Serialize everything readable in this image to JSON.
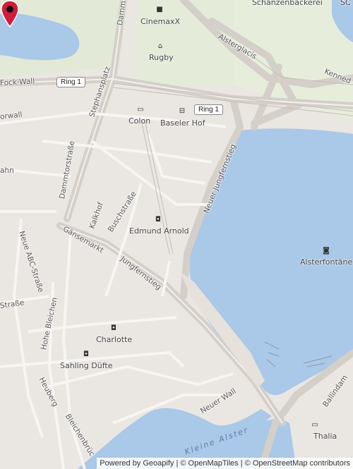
{
  "map": {
    "water_color": "#aac8e8",
    "land_color": "#eae6e1",
    "park_color": "#e4ecd9",
    "road_color": "#d2cdc6"
  },
  "labels": {
    "schanzenbackerei": "Schanzenbäckerei",
    "sc": "SC",
    "cinemaxx": "CinemaxX",
    "rugby": "Rugby",
    "alsterglacis": "Alsterglacis",
    "kennedy": "Kenned",
    "fock_wall": "Fock-Wall",
    "ring1_a": "Ring 1",
    "ring1_b": "Ring 1",
    "stephansplatz": "Stephansplatz",
    "dammtor_top": "Damm",
    "torwall": "orwall",
    "colon": "Colon",
    "baseler_hof": "Baseler Hof",
    "dammtorstrasse": "Dammtorstraße",
    "jungfernstieg_neuer": "Neuer Jungfernstieg",
    "ahn": "ahn",
    "kalkhof": "Kalkhof",
    "buschstrasse": "Buschstraße",
    "edmund_arnold": "Edmund Arnold",
    "gaensemarkt": "Gänsemarkt",
    "jungfernstieg": "Jungfernstieg",
    "neue_abc": "Neue ABC-Straße",
    "alsterfontaene": "Alsterfontäne",
    "strasse": "Straße",
    "hohe_bleichen": "Hohe Bleichen",
    "charlotte": "Charlotte",
    "sahling": "Sahling Düfte",
    "heuberg": "Heuberg",
    "bleichenbruecke": "Bleichenbrüc",
    "neuer_wall": "Neuer Wall",
    "kleine_alster": "Kleine Alster",
    "thalia": "Thalia",
    "ballindamm": "Ballindam"
  },
  "attribution": {
    "powered": "Powered by Geoapify",
    "sep1": "|",
    "openmaptiles": "© OpenMapTiles",
    "sep2": "|",
    "osm": "© OpenStreetMap contributors"
  },
  "icons": {
    "cinema": "cinema-icon",
    "sport": "sport-icon",
    "book": "book-icon",
    "hotel": "hotel-icon",
    "shop": "shop-icon",
    "camera": "camera-icon",
    "marker": "map-pin-icon"
  }
}
